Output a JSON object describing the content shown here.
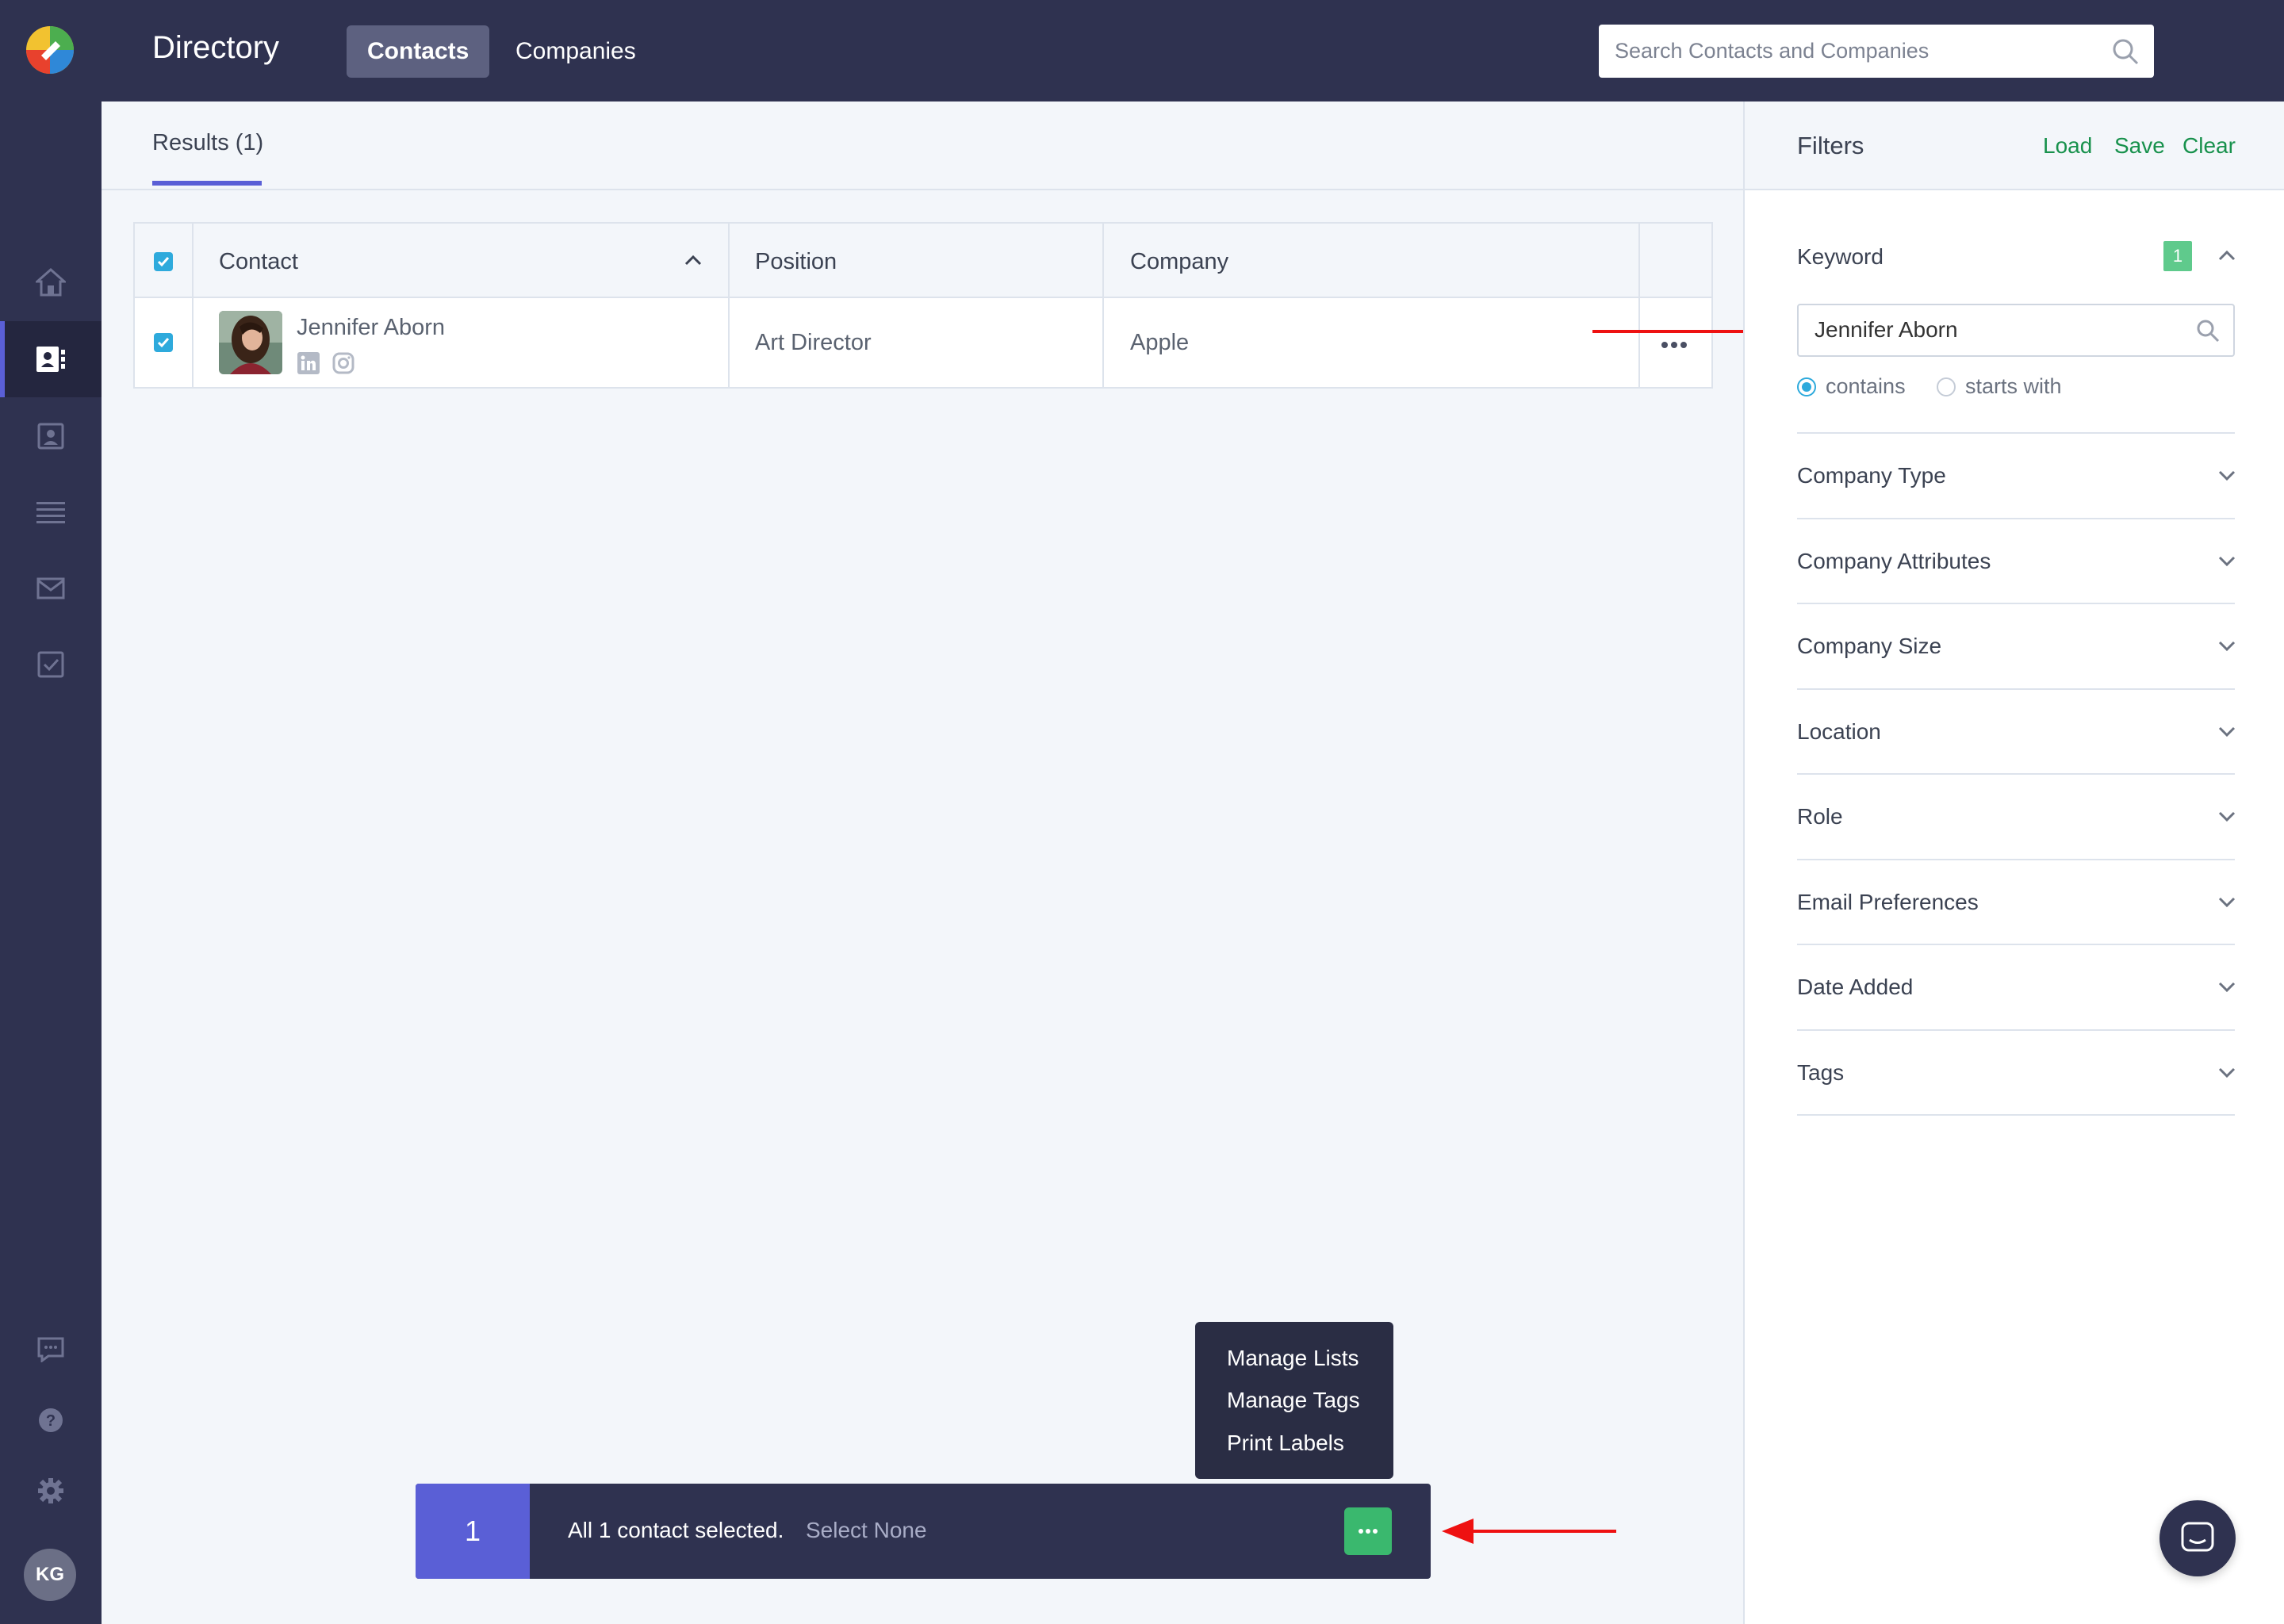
{
  "app": {
    "title": "Directory",
    "user_initials": "KG"
  },
  "tabs": [
    {
      "label": "Contacts",
      "active": true
    },
    {
      "label": "Companies",
      "active": false
    }
  ],
  "search": {
    "placeholder": "Search Contacts and Companies"
  },
  "results": {
    "tab_label": "Results (1)"
  },
  "table": {
    "headers": [
      "Contact",
      "Position",
      "Company"
    ],
    "rows": [
      {
        "name": "Jennifer Aborn",
        "position": "Art Director",
        "company": "Apple"
      }
    ]
  },
  "filters": {
    "title": "Filters",
    "actions": [
      "Load",
      "Save",
      "Clear"
    ],
    "keyword": {
      "label": "Keyword",
      "count": "1",
      "value": "Jennifer Aborn",
      "options": [
        "contains",
        "starts with"
      ],
      "selected": "contains"
    },
    "sections": [
      "Company Type",
      "Company Attributes",
      "Company Size",
      "Location",
      "Role",
      "Email Preferences",
      "Date Added",
      "Tags"
    ]
  },
  "bulk_menu": {
    "items": [
      "Manage Lists",
      "Manage Tags",
      "Print Labels"
    ]
  },
  "selection_bar": {
    "count": "1",
    "text": "All 1 contact selected.",
    "select_none": "Select None"
  },
  "colors": {
    "sidebar": "#2f3250",
    "accent": "#5a5fd6",
    "green": "#3ab86e",
    "checkbox": "#2eaadc",
    "annotation_arrow": "#ee1111"
  }
}
